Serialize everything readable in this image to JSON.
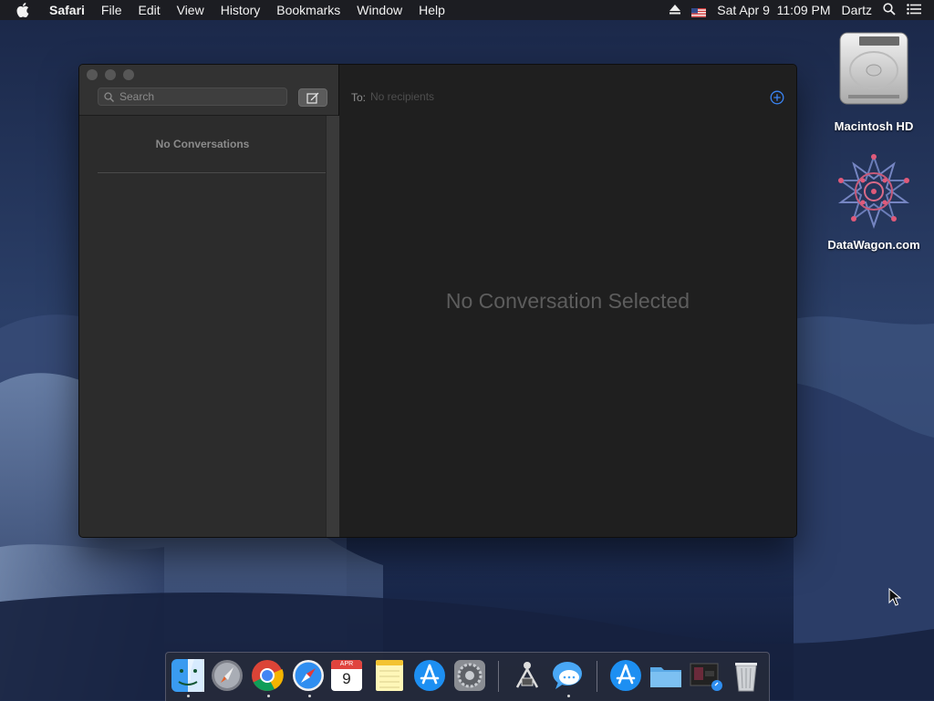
{
  "menubar": {
    "app_name": "Safari",
    "menus": [
      "File",
      "Edit",
      "View",
      "History",
      "Bookmarks",
      "Window",
      "Help"
    ],
    "datetime": "Sat Apr 9  11:09 PM",
    "user": "Dartz",
    "icons": [
      "apple-icon",
      "eject-icon",
      "us-flag-icon",
      "spotlight-search-icon",
      "notification-center-icon"
    ]
  },
  "messages": {
    "search_placeholder": "Search",
    "empty_list_text": "No Conversations",
    "to_label": "To:",
    "to_placeholder": "No recipients",
    "empty_detail_text": "No Conversation Selected"
  },
  "desktop": {
    "icons": [
      {
        "label": "Macintosh HD",
        "icon": "hard-drive-icon"
      },
      {
        "label": "DataWagon.com",
        "icon": "network-logo-icon"
      }
    ]
  },
  "dock": {
    "items": [
      {
        "icon": "finder-icon",
        "running": true
      },
      {
        "icon": "launchpad-icon",
        "running": false
      },
      {
        "icon": "chrome-icon",
        "running": true
      },
      {
        "icon": "safari-icon",
        "running": true
      },
      {
        "icon": "calendar-icon",
        "running": false,
        "calendar_month": "APR",
        "calendar_day": "9"
      },
      {
        "icon": "notes-icon",
        "running": false
      },
      {
        "icon": "app-store-icon",
        "running": false
      },
      {
        "icon": "system-preferences-icon",
        "running": false
      },
      {
        "icon": "directory-utility-icon",
        "running": false
      },
      {
        "icon": "messages-icon",
        "running": true
      },
      {
        "icon": "app-store-downloads-icon",
        "running": false
      },
      {
        "icon": "folder-icon",
        "running": false
      },
      {
        "icon": "screenshot-recent-icon",
        "running": false
      },
      {
        "icon": "trash-icon",
        "running": false
      }
    ]
  },
  "colors": {
    "accent_blue": "#3a84f4",
    "menubar_bg": "#1c1c20",
    "window_bg": "#1f1f1f",
    "sidebar_bg": "#2c2c2c"
  }
}
